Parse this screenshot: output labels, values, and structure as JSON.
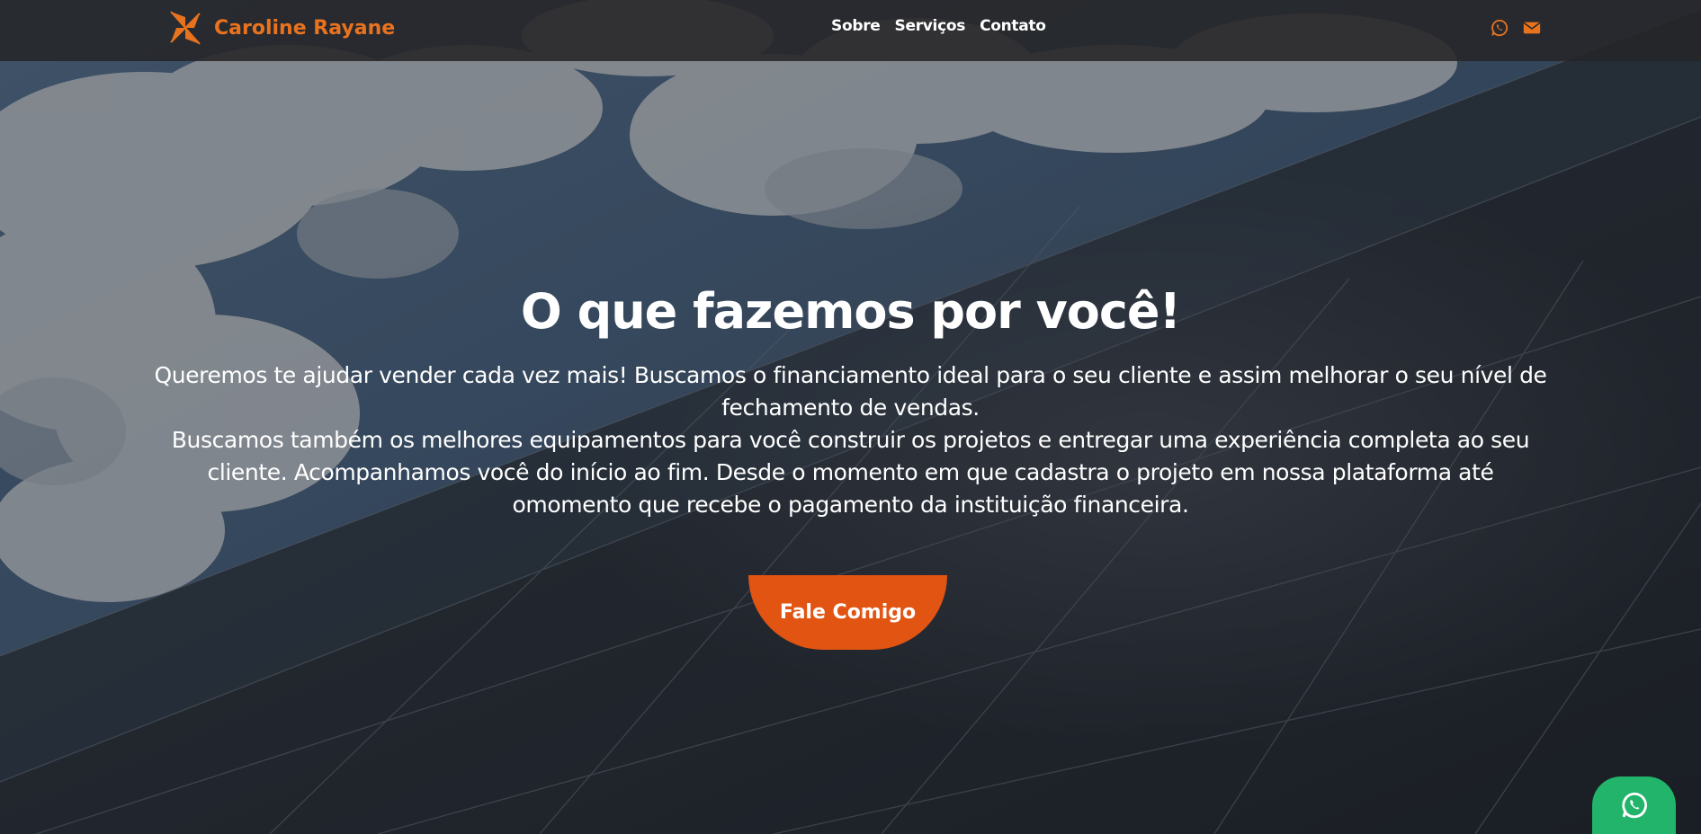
{
  "brand": {
    "name": "Caroline Rayane",
    "logo_icon": "pinwheel-logo-icon"
  },
  "nav": {
    "items": [
      {
        "label": "Sobre"
      },
      {
        "label": "Serviços"
      },
      {
        "label": "Contato"
      }
    ],
    "icons": [
      "whatsapp-icon",
      "envelope-icon"
    ]
  },
  "hero": {
    "title": "O que fazemos por você!",
    "paragraphs": [
      "Queremos te ajudar vender cada vez mais! Buscamos o financiamento ideal para o seu cliente e assim melhorar o seu nível de fechamento de vendas.",
      "Buscamos também os melhores equipamentos para você construir os projetos e entregar uma experiência completa ao seu cliente. Acompanhamos você do início ao fim. Desde o momento em que cadastra o projeto em nossa plataforma até omomento que recebe o pagamento da instituição financeira."
    ],
    "cta_label": "Fale Comigo",
    "background": "solar-panels-and-clouds-photo"
  },
  "floating": {
    "icon": "whatsapp-icon"
  },
  "colors": {
    "accent": "#e8731f",
    "cta": "#e25412",
    "whatsapp": "#22b46b",
    "navbar": "#262628"
  }
}
